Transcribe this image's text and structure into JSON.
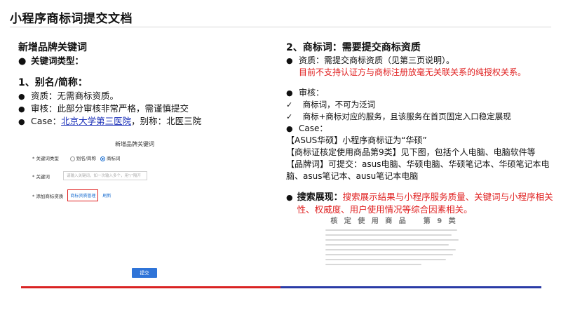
{
  "title": "小程序商标词提交文档",
  "left": {
    "heading": "新增品牌关键词",
    "kw_type": "关键词类型：",
    "alias_heading": "1、别名/简称：",
    "items": [
      {
        "label": "资质：无需商标资质。"
      },
      {
        "label": "审核：此部分审核非常严格，需谨慎提交"
      }
    ],
    "case_prefix": "Case：",
    "case_link": "北京大学第三医院",
    "case_suffix": "，别称：北医三院"
  },
  "form": {
    "title": "新增品牌关键词",
    "type_label": "* 关键词类型",
    "opt_alias": "别名/简称",
    "opt_brand": "商标词",
    "kw_label": "* 关键词",
    "kw_placeholder": "请输入关键词，如一次输入多个，用\"/\"隔开",
    "add_label": "* 添加商标资质",
    "add_link": "商标资质管理",
    "refresh": "刷新",
    "submit": "提交"
  },
  "right": {
    "heading": "2、商标词：需要提交商标资质",
    "qual": "资质：需提交商标资质（见第三页说明）。",
    "qual_note": "目前不支持认证方与商标注册放毫无关联关系的纯授权关系。",
    "review": "审核：",
    "checks": [
      "商标词，不可为泛词",
      "商标+商标对应的服务，且该服务在首页固定入口稳定展现"
    ],
    "case": "Case：",
    "case_lines": [
      "【ASUS华硕】小程序商标证为“华硕”",
      "【商标证核定使用商品第9类】见下图，包括个人电脑、电脑软件等",
      "【品牌词】可提交：asus电脑、华硕电脑、华硕笔记本、华硕笔记本电脑、asus笔记本、ausu笔记本电脑"
    ],
    "search_prefix": "搜索展现：",
    "search_text": "搜索展示结果与小程序服务质量、关键词与小程序相关性、权威度、用户使用情况等综合因素相关。"
  },
  "doc_image": {
    "head": "核 定 使 用 商 品",
    "num": "第  9  类"
  },
  "colors": {
    "red": "#e02020",
    "link": "#1a2fb8",
    "bar_red": "#d92323",
    "bar_blue": "#2a3ba6"
  }
}
